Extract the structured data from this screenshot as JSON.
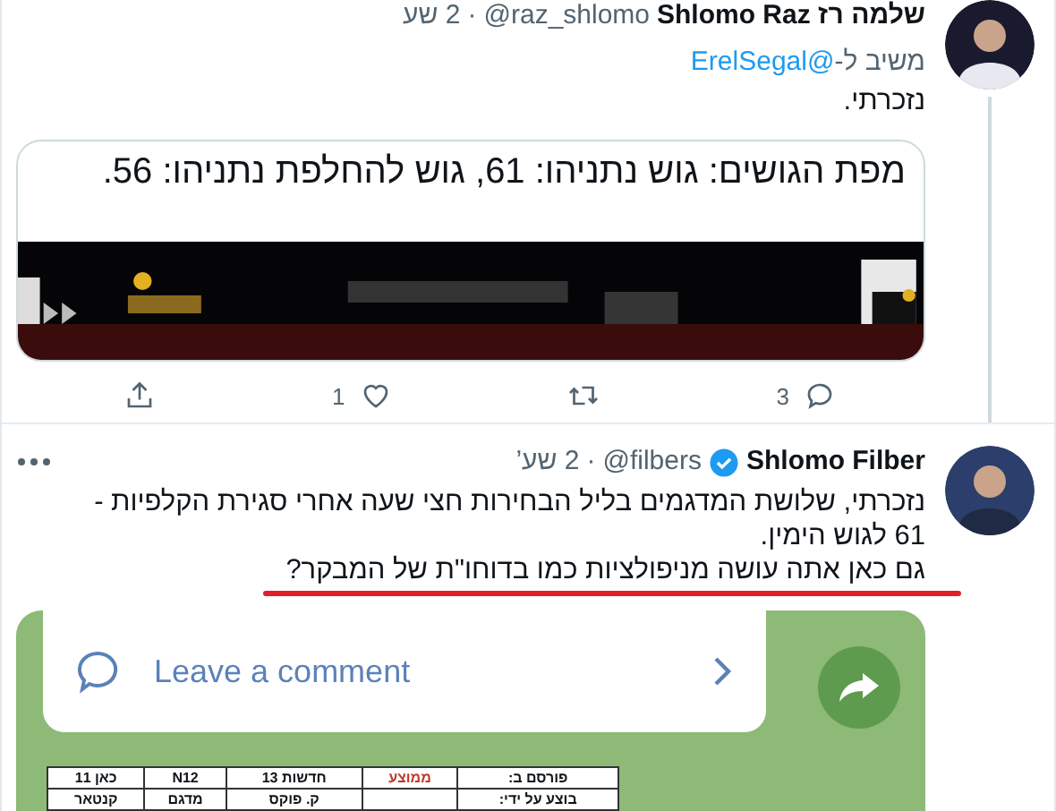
{
  "tweets": [
    {
      "name": "שלמה רז Shlomo Raz",
      "handle": "@raz_shlomo",
      "separator": "·",
      "time": "2 שע",
      "verified": false,
      "reply_prefix": "משיב ל-",
      "reply_to": "@ErelSegal",
      "text": "נזכרתי.",
      "card": {
        "title": "מפת הגושים: גוש נתניהו: 61, גוש להחלפת נתניהו: 56.",
        "kind": "picture"
      },
      "actions": {
        "replies": "3",
        "likes": "1"
      }
    },
    {
      "name": "Shlomo Filber",
      "handle": "@filbers",
      "separator": "·",
      "time": "2 שע’",
      "verified": true,
      "text": "נזכרתי, שלושת המדגמים בליל הבחירות חצי שעה אחרי סגירת הקלפיות -\n61 לגוש הימין.\nגם כאן אתה עושה מניפולציות כמו בדוחו\"ת של המבקר?",
      "underlined_line": true,
      "media": {
        "comment_label": "Leave a comment",
        "table": [
          [
            {
              "kind": "text",
              "text": "פורסם ב:"
            },
            {
              "kind": "text",
              "text": "ממוצע",
              "color": "#c0392b"
            },
            {
              "kind": "text",
              "text": "חדשות 13"
            },
            {
              "kind": "text",
              "text": "N12"
            },
            {
              "kind": "text",
              "text": "כאן 11"
            }
          ],
          [
            {
              "kind": "text",
              "text": "בוצע על ידי:"
            },
            {
              "kind": "blank"
            },
            {
              "kind": "text",
              "text": "ק. פוקס"
            },
            {
              "kind": "text",
              "text": "מדגם"
            },
            {
              "kind": "text",
              "text": "קנטאר"
            }
          ]
        ]
      }
    }
  ]
}
